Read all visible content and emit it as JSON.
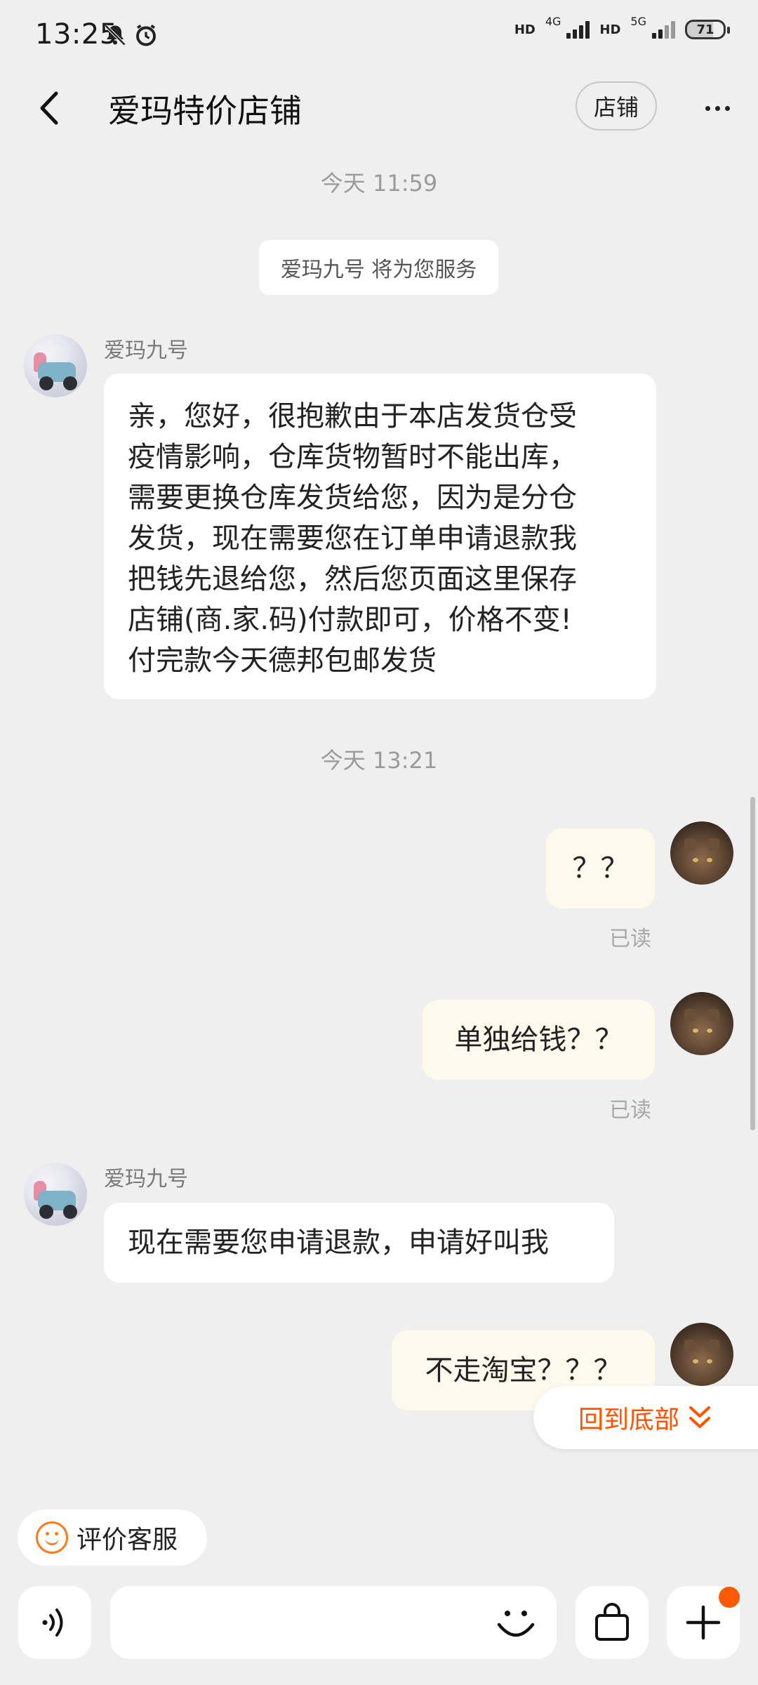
{
  "status_bar": {
    "time": "13:25",
    "net1_type": "4G",
    "net1_hd": "HD",
    "net2_type": "5G",
    "net2_hd": "HD",
    "battery": "71"
  },
  "header": {
    "title": "爱玛特价店铺",
    "shop_button": "店铺"
  },
  "chat": {
    "timestamp_1": "今天  11:59",
    "notice": "爱玛九号 将为您服务",
    "timestamp_2": "今天  13:21",
    "messages": [
      {
        "sender": "爱玛九号",
        "lines": [
          "亲，您好，很抱歉由于本店发货仓受",
          "疫情影响，仓库货物暂时不能出库，",
          "需要更换仓库发货给您，因为是分仓",
          "发货，现在需要您在订单申请退款我",
          "把钱先退给您，然后您页面这里保存",
          "店铺(商.家.码)付款即可，价格不变!",
          "付完款今天德邦包邮发货"
        ]
      },
      {
        "text": "？？",
        "status": "已读"
      },
      {
        "text": "单独给钱？？",
        "status": "已读"
      },
      {
        "sender": "爱玛九号",
        "text": "现在需要您申请退款，申请好叫我"
      },
      {
        "text": "不走淘宝？？？"
      }
    ]
  },
  "scroll_to_bottom": "回到底部",
  "rate_service": "评价客服",
  "input": {
    "placeholder": ""
  }
}
